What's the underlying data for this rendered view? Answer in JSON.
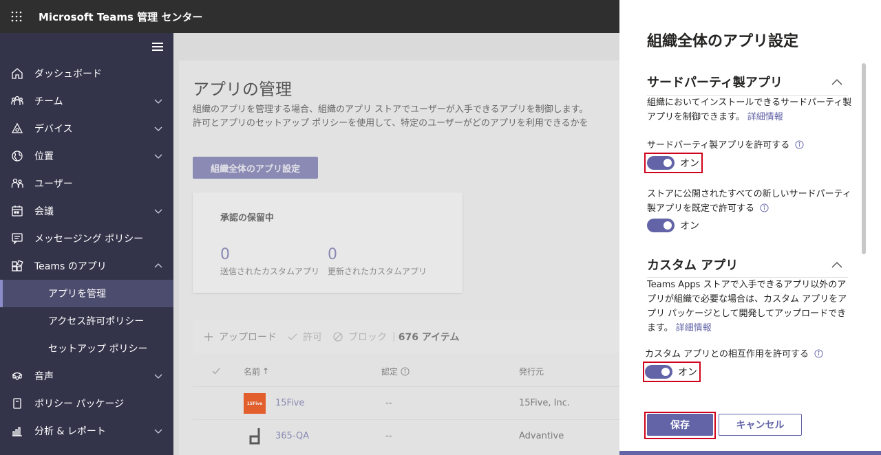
{
  "topbar": {
    "title": "Microsoft Teams 管理 センター"
  },
  "sidebar": {
    "items": [
      {
        "label": "ダッシュボード",
        "icon": "home-icon"
      },
      {
        "label": "チーム",
        "icon": "teams-icon"
      },
      {
        "label": "デバイス",
        "icon": "devices-icon"
      },
      {
        "label": "位置",
        "icon": "globe-icon"
      },
      {
        "label": "ユーザー",
        "icon": "users-icon"
      },
      {
        "label": "会議",
        "icon": "calendar-icon"
      },
      {
        "label": "メッセージング ポリシー",
        "icon": "chat-icon"
      },
      {
        "label": "Teams のアプリ",
        "icon": "apps-icon"
      },
      {
        "label": "アプリを管理"
      },
      {
        "label": "アクセス許可ポリシー"
      },
      {
        "label": "セットアップ ポリシー"
      },
      {
        "label": "音声",
        "icon": "voice-icon"
      },
      {
        "label": "ポリシー パッケージ",
        "icon": "package-icon"
      },
      {
        "label": "分析 & レポート",
        "icon": "analytics-icon"
      }
    ]
  },
  "main": {
    "title": "アプリの管理",
    "desc1": "組織のアプリを管理する場合、組織のアプリ ストアでユーザーが入手できるアプリを制御します。",
    "desc2": "許可とアプリのセットアップ ポリシーを使用して、特定のユーザーがどのアプリを利用できるかを",
    "org_button": "組織全体のアプリ設定",
    "pending": {
      "title": "承認の保留中",
      "submitted_count": "0",
      "submitted_label": "送信されたカスタムアプリ",
      "updated_count": "0",
      "updated_label": "更新されたカスタムアプリ"
    },
    "toolbar": {
      "upload": "アップロード",
      "allow": "許可",
      "block": "ブロック",
      "count": "676 アイテム"
    },
    "table": {
      "col_name": "名前",
      "col_cert": "認定",
      "col_publisher": "発行元",
      "rows": [
        {
          "name": "15Five",
          "cert": "--",
          "publisher": "15Five, Inc."
        },
        {
          "name": "365-QA",
          "cert": "--",
          "publisher": "Advantive"
        }
      ]
    }
  },
  "panel": {
    "title": "組織全体のアプリ設定",
    "third_party": {
      "heading": "サードパーティ製アプリ",
      "desc": "組織においてインストールできるサードパーティ製アプリを制御できます。",
      "desc_link": "詳細情報",
      "allow_label": "サードパーティ製アプリを許可する",
      "allow_state": "オン",
      "new_apps_label": "ストアに公開されたすべての新しいサードパーティ製アプリを既定で許可する",
      "new_apps_state": "オン"
    },
    "custom": {
      "heading": "カスタム アプリ",
      "desc": "Teams Apps ストアで入手できるアプリ以外のアプリが組織で必要な場合は、カスタム アプリをアプリ パッケージとして開発してアップロードできます。",
      "desc_link": "詳細情報",
      "interact_label": "カスタム アプリとの相互作用を許可する",
      "interact_state": "オン"
    },
    "save": "保存",
    "cancel": "キャンセル"
  },
  "colors": {
    "accent": "#6264a7",
    "sidebar": "#33344a",
    "topbar": "#2f2f2f",
    "highlight": "#d0021b"
  }
}
